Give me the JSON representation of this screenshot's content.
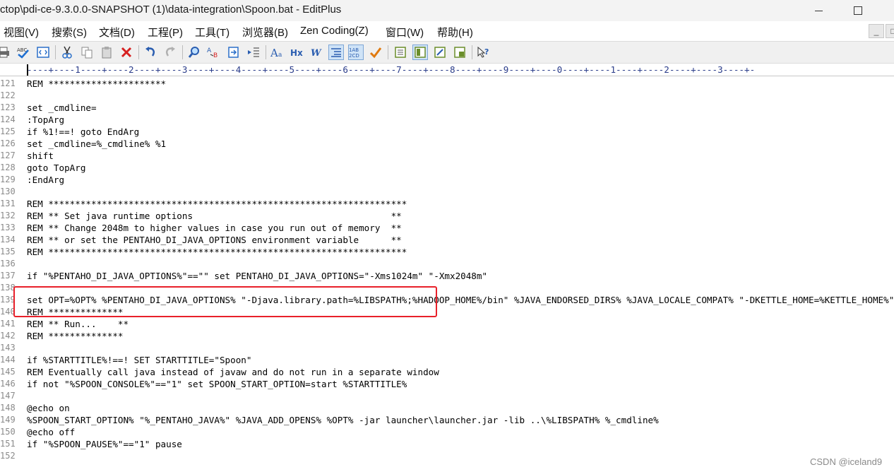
{
  "window": {
    "title": "ctop\\pdi-ce-9.3.0.0-SNAPSHOT (1)\\data-integration\\Spoon.bat - EditPlus",
    "minimize_icon": "minimize-icon",
    "maximize_icon": "maximize-icon"
  },
  "menu": {
    "items": [
      "视图(V)",
      "搜索(S)",
      "文档(D)",
      "工程(P)",
      "工具(T)",
      "浏览器(B)",
      "Zen Coding(Z)",
      "窗口(W)",
      "帮助(H)"
    ],
    "mdi_min": "_",
    "mdi_restore": "□"
  },
  "toolbar": {
    "icons": [
      "print-icon",
      "spellcheck-icon",
      "browser-preview-icon",
      "cut-icon",
      "copy-icon",
      "paste-icon",
      "delete-icon",
      "undo-icon",
      "redo-icon",
      "find-icon",
      "replace-icon",
      "goto-icon",
      "indent-icon",
      "font-icon",
      "hex-icon",
      "word-wrap-icon",
      "line-number-icon",
      "ruler-icon",
      "spellcheck-toggle-icon",
      "view-icon-1",
      "view-icon-2",
      "view-icon-3",
      "view-icon-4",
      "help-icon"
    ]
  },
  "ruler": {
    "text": "----+----1----+----2----+----3----+----4----+----5----+----6----+----7----+----8----+----9----+----0----+----1----+----2----+----3----+-"
  },
  "editor": {
    "lines": [
      {
        "num": "121",
        "text": "REM **********************"
      },
      {
        "num": "122",
        "text": ""
      },
      {
        "num": "123",
        "text": "set _cmdline="
      },
      {
        "num": "124",
        "text": ":TopArg"
      },
      {
        "num": "125",
        "text": "if %1!==! goto EndArg"
      },
      {
        "num": "126",
        "text": "set _cmdline=%_cmdline% %1"
      },
      {
        "num": "127",
        "text": "shift"
      },
      {
        "num": "128",
        "text": "goto TopArg"
      },
      {
        "num": "129",
        "text": ":EndArg"
      },
      {
        "num": "130",
        "text": ""
      },
      {
        "num": "131",
        "text": "REM *******************************************************************"
      },
      {
        "num": "132",
        "text": "REM ** Set java runtime options                                     **"
      },
      {
        "num": "133",
        "text": "REM ** Change 2048m to higher values in case you run out of memory  **"
      },
      {
        "num": "134",
        "text": "REM ** or set the PENTAHO_DI_JAVA_OPTIONS environment variable      **"
      },
      {
        "num": "135",
        "text": "REM *******************************************************************"
      },
      {
        "num": "136",
        "text": ""
      },
      {
        "num": "137",
        "text": "if \"%PENTAHO_DI_JAVA_OPTIONS%\"==\"\" set PENTAHO_DI_JAVA_OPTIONS=\"-Xms1024m\" \"-Xmx2048m\""
      },
      {
        "num": "138",
        "text": ""
      },
      {
        "num": "139",
        "text": "set OPT=%OPT% %PENTAHO_DI_JAVA_OPTIONS% \"-Djava.library.path=%LIBSPATH%;%HADOOP_HOME%/bin\" %JAVA_ENDORSED_DIRS% %JAVA_LOCALE_COMPAT% \"-DKETTLE_HOME=%KETTLE_HOME%\""
      },
      {
        "num": "140",
        "text": "REM **************"
      },
      {
        "num": "141",
        "text": "REM ** Run...    **"
      },
      {
        "num": "142",
        "text": "REM **************"
      },
      {
        "num": "143",
        "text": ""
      },
      {
        "num": "144",
        "text": "if %STARTTITLE%!==! SET STARTTITLE=\"Spoon\""
      },
      {
        "num": "145",
        "text": "REM Eventually call java instead of javaw and do not run in a separate window"
      },
      {
        "num": "146",
        "text": "if not \"%SPOON_CONSOLE%\"==\"1\" set SPOON_START_OPTION=start %STARTTITLE%"
      },
      {
        "num": "147",
        "text": ""
      },
      {
        "num": "148",
        "text": "@echo on"
      },
      {
        "num": "149",
        "text": "%SPOON_START_OPTION% \"%_PENTAHO_JAVA%\" %JAVA_ADD_OPENS% %OPT% -jar launcher\\launcher.jar -lib ..\\%LIBSPATH% %_cmdline%"
      },
      {
        "num": "150",
        "text": "@echo off"
      },
      {
        "num": "151",
        "text": "if \"%SPOON_PAUSE%\"==\"1\" pause"
      },
      {
        "num": "152",
        "text": ""
      }
    ]
  },
  "watermark": "CSDN @iceland9"
}
